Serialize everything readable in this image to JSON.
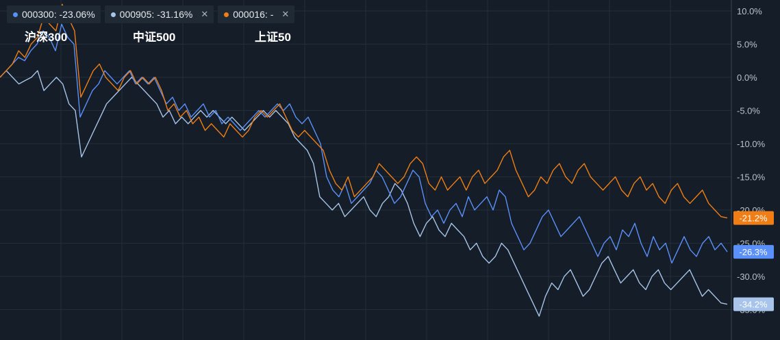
{
  "legend": [
    {
      "code": "000300",
      "value": "-23.06%",
      "color": "#5b8ff9",
      "closable": false
    },
    {
      "code": "000905",
      "value": "-31.16%",
      "color": "#a8c4ea",
      "closable": true
    },
    {
      "code": "000016",
      "value": "-",
      "color": "#f07e14",
      "closable": true
    }
  ],
  "index_names": [
    "沪深300",
    "中证500",
    "上证50"
  ],
  "colors": {
    "background": "#151e28",
    "grid": "#232e3a",
    "axis_line": "#3a4552"
  },
  "chart_data": {
    "type": "line",
    "ylim": [
      -36,
      11
    ],
    "yticks": [
      10,
      5,
      0,
      -5,
      -10,
      -15,
      -20,
      -25,
      -30,
      -35
    ],
    "ytick_labels": [
      "10.0%",
      "5.0%",
      "0.0%",
      "-5.0%",
      "-10.0%",
      "-15.0%",
      "-20.0%",
      "-25.0%",
      "-30.0%",
      "-35.0%"
    ],
    "grid": true,
    "series": [
      {
        "code": "000300",
        "name": "沪深300",
        "color": "#5b8ff9",
        "end_label": "-26.3%",
        "end_value": -26.3,
        "values": [
          0,
          1,
          2,
          3,
          2.5,
          4,
          5,
          7,
          6,
          4,
          8,
          6,
          5,
          -6,
          -4,
          -2,
          -1,
          1,
          0,
          -1,
          0,
          1,
          -1,
          0,
          -1,
          0,
          -2,
          -4,
          -3,
          -5,
          -4,
          -6,
          -5,
          -4,
          -6,
          -5,
          -7,
          -6,
          -7,
          -8,
          -7,
          -6,
          -5,
          -6,
          -5,
          -4,
          -5,
          -4,
          -6,
          -7,
          -6,
          -8,
          -10,
          -15,
          -17,
          -18,
          -16,
          -19,
          -18,
          -17,
          -16,
          -14,
          -15,
          -17,
          -19,
          -18,
          -16,
          -14,
          -15,
          -19,
          -21,
          -20,
          -22,
          -20,
          -19,
          -21,
          -18,
          -20,
          -19,
          -18,
          -20,
          -17,
          -18,
          -22,
          -24,
          -26,
          -25,
          -23,
          -21,
          -20,
          -22,
          -24,
          -23,
          -22,
          -21,
          -23,
          -25,
          -27,
          -25,
          -24,
          -26,
          -23,
          -24,
          -22,
          -25,
          -27,
          -24,
          -26,
          -25,
          -28,
          -26,
          -24,
          -26,
          -27,
          -25,
          -24,
          -26,
          -25,
          -26.3
        ]
      },
      {
        "code": "000905",
        "name": "中证500",
        "color": "#a8c4ea",
        "end_label": "-34.2%",
        "end_value": -34.2,
        "values": [
          0,
          1,
          0,
          -1,
          -0.5,
          0,
          1,
          -2,
          -1,
          0,
          -1,
          -4,
          -5,
          -12,
          -10,
          -8,
          -6,
          -4,
          -3,
          -2,
          -1,
          0,
          -1,
          -2,
          -3,
          -4,
          -6,
          -5,
          -7,
          -6,
          -7,
          -6,
          -5,
          -6,
          -5,
          -6,
          -7,
          -6,
          -7,
          -8,
          -7,
          -6,
          -5,
          -6,
          -5,
          -6,
          -7,
          -9,
          -10,
          -11,
          -13,
          -18,
          -19,
          -20,
          -19,
          -21,
          -20,
          -19,
          -18,
          -20,
          -21,
          -19,
          -18,
          -16,
          -17,
          -19,
          -22,
          -24,
          -22,
          -21,
          -23,
          -24,
          -22,
          -23,
          -24,
          -26,
          -25,
          -27,
          -28,
          -27,
          -25,
          -26,
          -28,
          -30,
          -32,
          -34,
          -36,
          -33,
          -31,
          -32,
          -30,
          -29,
          -31,
          -33,
          -32,
          -30,
          -28,
          -27,
          -29,
          -31,
          -30,
          -29,
          -31,
          -32,
          -30,
          -29,
          -31,
          -32,
          -31,
          -30,
          -29,
          -31,
          -33,
          -32,
          -33,
          -34,
          -34.2
        ]
      },
      {
        "code": "000016",
        "name": "上证50",
        "color": "#f07e14",
        "end_label": "-21.2%",
        "end_value": -21.2,
        "values": [
          0,
          1,
          2,
          4,
          3,
          5,
          6,
          9,
          8,
          7,
          11,
          9,
          7,
          -3,
          -1,
          1,
          2,
          0,
          -1,
          -2,
          0,
          1,
          -1,
          0,
          -1,
          0,
          -2,
          -5,
          -4,
          -6,
          -5,
          -7,
          -6,
          -8,
          -7,
          -8,
          -9,
          -7,
          -8,
          -9,
          -8,
          -6,
          -5,
          -6,
          -5,
          -4,
          -6,
          -8,
          -9,
          -8,
          -9,
          -10,
          -11,
          -14,
          -16,
          -17,
          -15,
          -18,
          -17,
          -16,
          -15,
          -13,
          -14,
          -15,
          -16,
          -15,
          -13,
          -12,
          -13,
          -16,
          -17,
          -15,
          -17,
          -16,
          -15,
          -17,
          -15,
          -14,
          -16,
          -15,
          -14,
          -12,
          -11,
          -14,
          -16,
          -18,
          -17,
          -15,
          -16,
          -14,
          -13,
          -15,
          -16,
          -14,
          -13,
          -15,
          -16,
          -17,
          -16,
          -15,
          -17,
          -18,
          -16,
          -15,
          -17,
          -16,
          -18,
          -19,
          -17,
          -16,
          -18,
          -19,
          -18,
          -17,
          -19,
          -20,
          -21,
          -21.2
        ]
      }
    ]
  }
}
